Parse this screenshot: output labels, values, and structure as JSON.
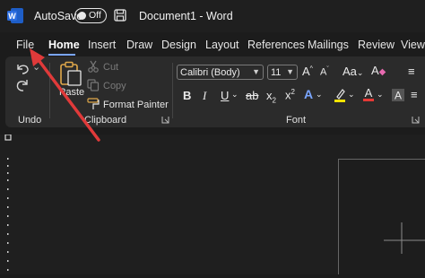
{
  "titlebar": {
    "autosave_label": "AutoSave",
    "autosave_state": "Off",
    "document_title": "Document1  -  Word"
  },
  "tabs": [
    "File",
    "Home",
    "Insert",
    "Draw",
    "Design",
    "Layout",
    "References",
    "Mailings",
    "Review",
    "View"
  ],
  "active_tab": "Home",
  "ribbon": {
    "undo_group_label": "Undo",
    "clipboard": {
      "paste_label": "Paste",
      "cut_label": "Cut",
      "copy_label": "Copy",
      "format_painter_label": "Format Painter",
      "group_label": "Clipboard"
    },
    "font": {
      "font_name": "Calibri (Body)",
      "font_size": "11",
      "group_label": "Font"
    }
  },
  "colors": {
    "accent_underline": "#7aa6ff",
    "annotation_arrow": "#e03a3a",
    "word_blue": "#2b6de0",
    "highlight_yellow": "#f3e300",
    "font_color_red": "#e53935"
  }
}
